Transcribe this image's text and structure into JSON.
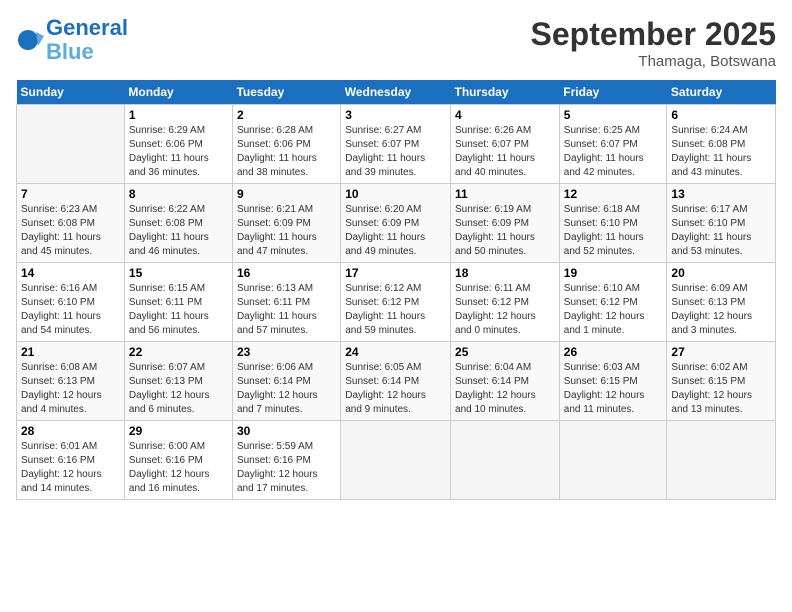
{
  "logo": {
    "line1": "General",
    "line2": "Blue"
  },
  "title": "September 2025",
  "location": "Thamaga, Botswana",
  "days_header": [
    "Sunday",
    "Monday",
    "Tuesday",
    "Wednesday",
    "Thursday",
    "Friday",
    "Saturday"
  ],
  "weeks": [
    [
      {
        "day": "",
        "info": ""
      },
      {
        "day": "1",
        "info": "Sunrise: 6:29 AM\nSunset: 6:06 PM\nDaylight: 11 hours\nand 36 minutes."
      },
      {
        "day": "2",
        "info": "Sunrise: 6:28 AM\nSunset: 6:06 PM\nDaylight: 11 hours\nand 38 minutes."
      },
      {
        "day": "3",
        "info": "Sunrise: 6:27 AM\nSunset: 6:07 PM\nDaylight: 11 hours\nand 39 minutes."
      },
      {
        "day": "4",
        "info": "Sunrise: 6:26 AM\nSunset: 6:07 PM\nDaylight: 11 hours\nand 40 minutes."
      },
      {
        "day": "5",
        "info": "Sunrise: 6:25 AM\nSunset: 6:07 PM\nDaylight: 11 hours\nand 42 minutes."
      },
      {
        "day": "6",
        "info": "Sunrise: 6:24 AM\nSunset: 6:08 PM\nDaylight: 11 hours\nand 43 minutes."
      }
    ],
    [
      {
        "day": "7",
        "info": "Sunrise: 6:23 AM\nSunset: 6:08 PM\nDaylight: 11 hours\nand 45 minutes."
      },
      {
        "day": "8",
        "info": "Sunrise: 6:22 AM\nSunset: 6:08 PM\nDaylight: 11 hours\nand 46 minutes."
      },
      {
        "day": "9",
        "info": "Sunrise: 6:21 AM\nSunset: 6:09 PM\nDaylight: 11 hours\nand 47 minutes."
      },
      {
        "day": "10",
        "info": "Sunrise: 6:20 AM\nSunset: 6:09 PM\nDaylight: 11 hours\nand 49 minutes."
      },
      {
        "day": "11",
        "info": "Sunrise: 6:19 AM\nSunset: 6:09 PM\nDaylight: 11 hours\nand 50 minutes."
      },
      {
        "day": "12",
        "info": "Sunrise: 6:18 AM\nSunset: 6:10 PM\nDaylight: 11 hours\nand 52 minutes."
      },
      {
        "day": "13",
        "info": "Sunrise: 6:17 AM\nSunset: 6:10 PM\nDaylight: 11 hours\nand 53 minutes."
      }
    ],
    [
      {
        "day": "14",
        "info": "Sunrise: 6:16 AM\nSunset: 6:10 PM\nDaylight: 11 hours\nand 54 minutes."
      },
      {
        "day": "15",
        "info": "Sunrise: 6:15 AM\nSunset: 6:11 PM\nDaylight: 11 hours\nand 56 minutes."
      },
      {
        "day": "16",
        "info": "Sunrise: 6:13 AM\nSunset: 6:11 PM\nDaylight: 11 hours\nand 57 minutes."
      },
      {
        "day": "17",
        "info": "Sunrise: 6:12 AM\nSunset: 6:12 PM\nDaylight: 11 hours\nand 59 minutes."
      },
      {
        "day": "18",
        "info": "Sunrise: 6:11 AM\nSunset: 6:12 PM\nDaylight: 12 hours\nand 0 minutes."
      },
      {
        "day": "19",
        "info": "Sunrise: 6:10 AM\nSunset: 6:12 PM\nDaylight: 12 hours\nand 1 minute."
      },
      {
        "day": "20",
        "info": "Sunrise: 6:09 AM\nSunset: 6:13 PM\nDaylight: 12 hours\nand 3 minutes."
      }
    ],
    [
      {
        "day": "21",
        "info": "Sunrise: 6:08 AM\nSunset: 6:13 PM\nDaylight: 12 hours\nand 4 minutes."
      },
      {
        "day": "22",
        "info": "Sunrise: 6:07 AM\nSunset: 6:13 PM\nDaylight: 12 hours\nand 6 minutes."
      },
      {
        "day": "23",
        "info": "Sunrise: 6:06 AM\nSunset: 6:14 PM\nDaylight: 12 hours\nand 7 minutes."
      },
      {
        "day": "24",
        "info": "Sunrise: 6:05 AM\nSunset: 6:14 PM\nDaylight: 12 hours\nand 9 minutes."
      },
      {
        "day": "25",
        "info": "Sunrise: 6:04 AM\nSunset: 6:14 PM\nDaylight: 12 hours\nand 10 minutes."
      },
      {
        "day": "26",
        "info": "Sunrise: 6:03 AM\nSunset: 6:15 PM\nDaylight: 12 hours\nand 11 minutes."
      },
      {
        "day": "27",
        "info": "Sunrise: 6:02 AM\nSunset: 6:15 PM\nDaylight: 12 hours\nand 13 minutes."
      }
    ],
    [
      {
        "day": "28",
        "info": "Sunrise: 6:01 AM\nSunset: 6:16 PM\nDaylight: 12 hours\nand 14 minutes."
      },
      {
        "day": "29",
        "info": "Sunrise: 6:00 AM\nSunset: 6:16 PM\nDaylight: 12 hours\nand 16 minutes."
      },
      {
        "day": "30",
        "info": "Sunrise: 5:59 AM\nSunset: 6:16 PM\nDaylight: 12 hours\nand 17 minutes."
      },
      {
        "day": "",
        "info": ""
      },
      {
        "day": "",
        "info": ""
      },
      {
        "day": "",
        "info": ""
      },
      {
        "day": "",
        "info": ""
      }
    ]
  ]
}
